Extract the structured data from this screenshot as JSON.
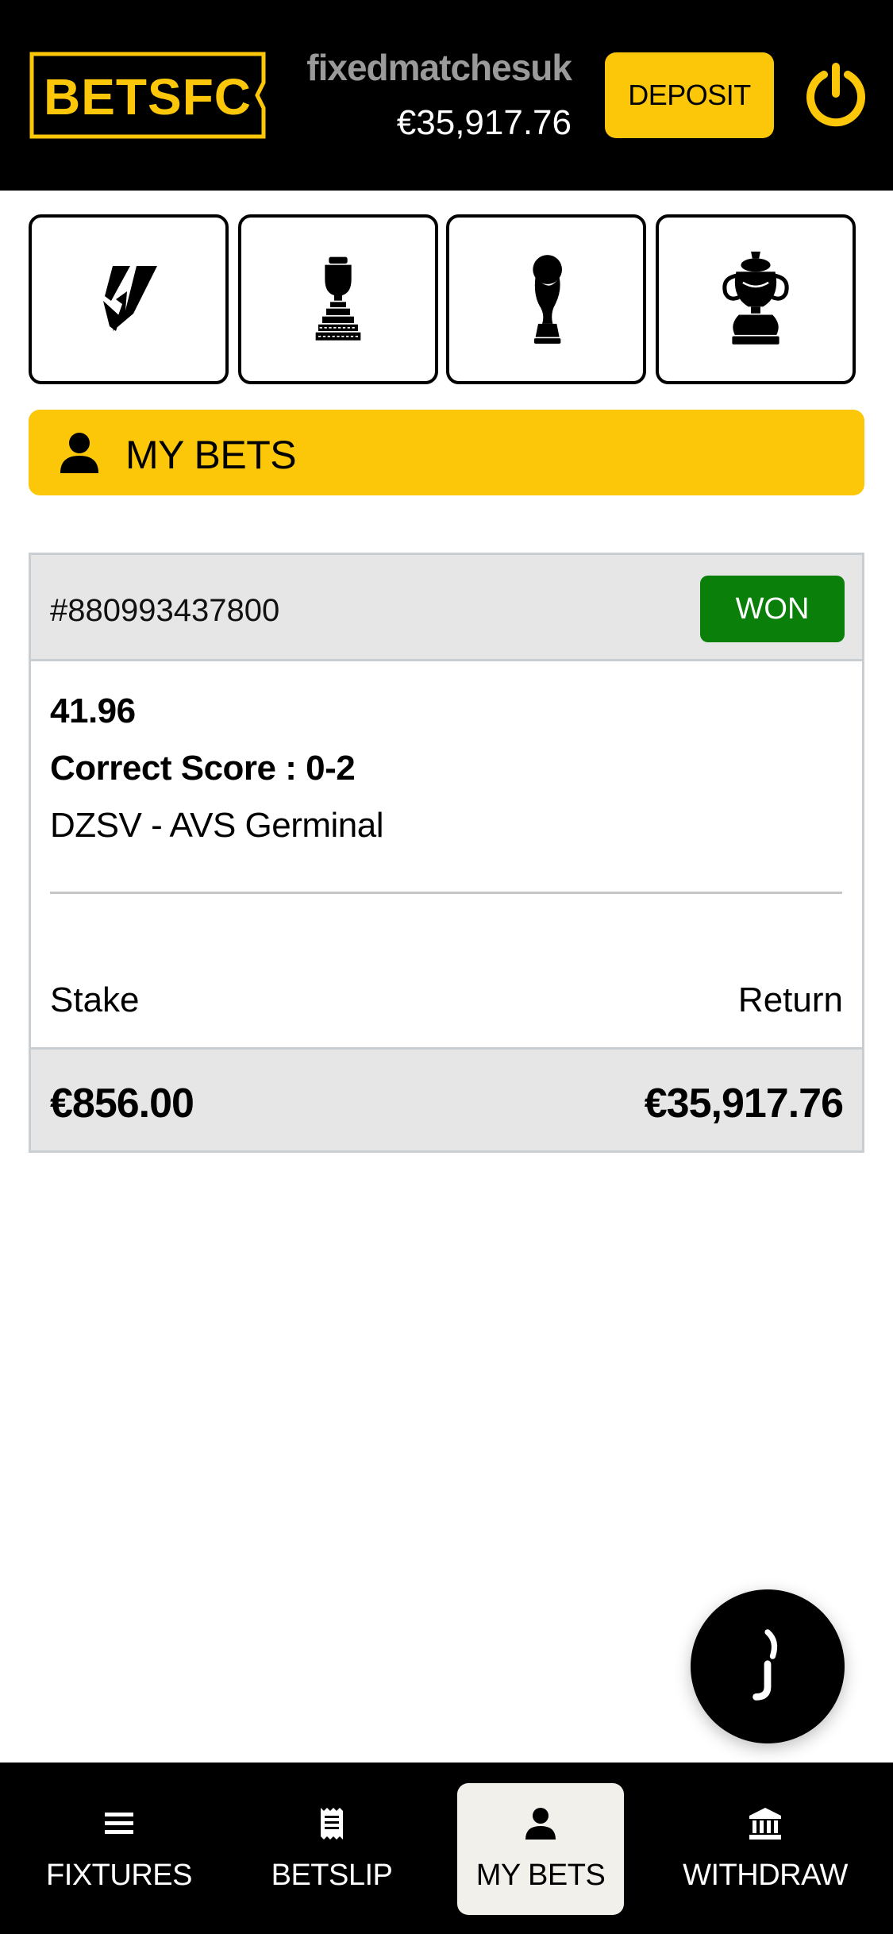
{
  "header": {
    "logo_text": "BETSFC",
    "username": "fixedmatchesuk",
    "balance": "€35,917.76",
    "deposit_label": "DEPOSIT",
    "power_icon": "power-icon"
  },
  "competitions": [
    {
      "name": "laliga-icon"
    },
    {
      "name": "copa-america-trophy-icon"
    },
    {
      "name": "world-cup-trophy-icon"
    },
    {
      "name": "fa-cup-trophy-icon"
    }
  ],
  "banner": {
    "title": "MY BETS",
    "icon": "user-icon"
  },
  "bet": {
    "id": "#880993437800",
    "status": "WON",
    "odds": "41.96",
    "market": "Correct Score : 0-2",
    "fixture": "DZSV - AVS Germinal",
    "stake_label": "Stake",
    "return_label": "Return",
    "stake_value": "€856.00",
    "return_value": "€35,917.76"
  },
  "chat": {
    "icon": "chat-support-icon"
  },
  "nav": {
    "items": [
      {
        "label": "FIXTURES",
        "icon": "menu-icon"
      },
      {
        "label": "BETSLIP",
        "icon": "receipt-icon"
      },
      {
        "label": "MY BETS",
        "icon": "user-icon",
        "active": true
      },
      {
        "label": "WITHDRAW",
        "icon": "bank-icon"
      }
    ]
  },
  "colors": {
    "brand_yellow": "#fcc708",
    "header_bg": "#000000",
    "won_green": "#0a800a",
    "card_grey": "#e6e6e6",
    "username_grey": "#9a9a9a"
  }
}
